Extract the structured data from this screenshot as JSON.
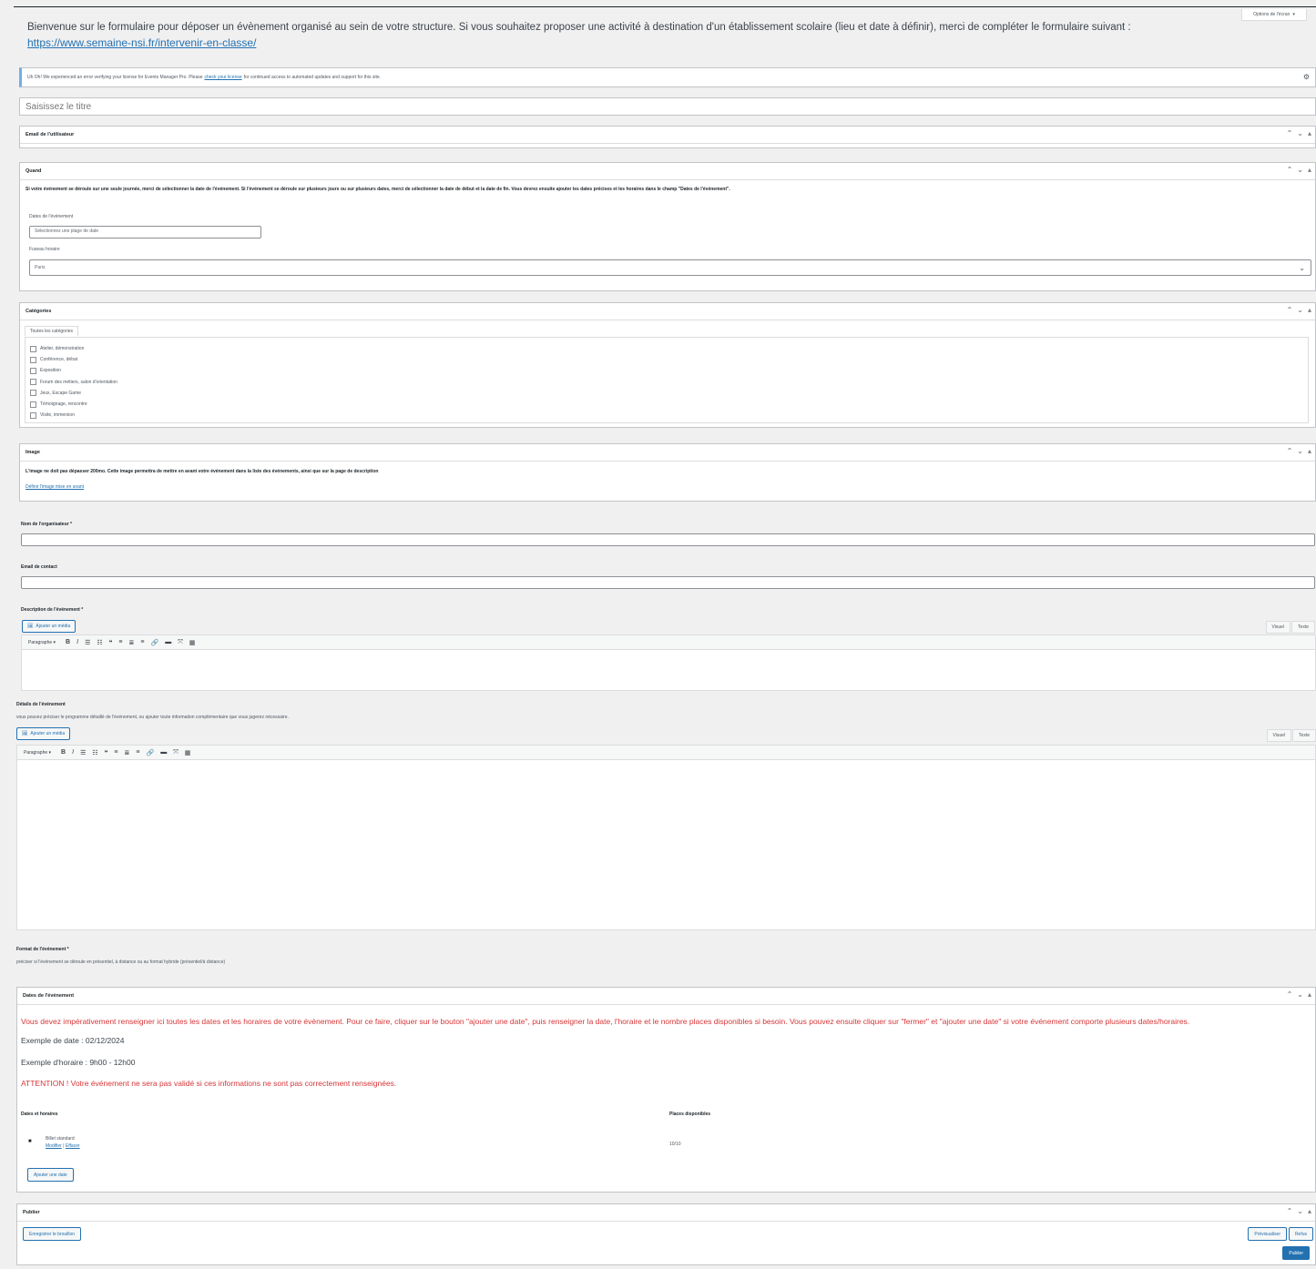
{
  "screen_options": "Options de l'écran",
  "intro": {
    "text": "Bienvenue sur le formulaire pour déposer un évènement organisé au sein de votre structure. Si vous souhaitez proposer une activité à destination d'un établissement scolaire (lieu et date à définir), merci de compléter le formulaire suivant :",
    "link": "https://www.semaine-nsi.fr/intervenir-en-classe/"
  },
  "notice": {
    "before": "Uh Oh! We experienced an error verifying your license for Events Manager Pro. Please",
    "link": "check your license",
    "after": "for continued access to automated updates and support for this site."
  },
  "title_placeholder": "Saisissez le titre",
  "email_box": {
    "title": "Email de l'utilisateur"
  },
  "when_box": {
    "title": "Quand",
    "help": "Si votre événement se déroule sur une seule journée, merci de sélectionner la date de l'événement. Si l'événement se déroule sur plusieurs jours ou sur plusieurs dates, merci de sélectionner la date de début et la date de fin. Vous devrez ensuite ajouter les dates précises et les horaires dans le champ \"Dates de l'événement\".",
    "dates_label": "Dates de l'événement",
    "dates_placeholder": "Sélectionnez une plage de date",
    "tz_label": "Fuseau horaire",
    "tz_value": "Paris"
  },
  "categories_box": {
    "title": "Catégories",
    "tab": "Toutes les catégories",
    "items": [
      "Atelier, démonstration",
      "Conférence, débat",
      "Exposition",
      "Forum des métiers, salon d'orientation",
      "Jeux, Escape Game",
      "Témoignage, rencontre",
      "Visite, immersion"
    ]
  },
  "image_box": {
    "title": "Image",
    "help": "L'image ne doit pas dépasser 200mo. Cette image permettra de mettre en avant votre événement dans la liste des événements, ainsi que sur la page de description",
    "link": "Définir l'image mise en avant"
  },
  "organizer": {
    "label": "Nom de l'organisateur *"
  },
  "contact": {
    "label": "Email de contact"
  },
  "description": {
    "label": "Description de l'événement *",
    "media": "Ajouter un média",
    "visual": "Visuel",
    "text": "Texte",
    "paragraph": "Paragraphe"
  },
  "details": {
    "label": "Détails de l'événement",
    "help": "vous pouvez préciser le programme détaillé de l'événement, ou ajouter toute information complémentaire que vous jugerez nécessaire.",
    "media": "Ajouter un média",
    "visual": "Visuel",
    "text": "Texte",
    "paragraph": "Paragraphe"
  },
  "format": {
    "label": "Format de l'événement *",
    "help": "préciser si l'événement se déroule en présentiel, à distance ou au format hybride (présentiel/à distance)"
  },
  "dates_box": {
    "title": "Dates de l'événement",
    "instructions": "Vous devez impérativement renseigner ici toutes les dates et les horaires de votre évènement. Pour ce faire, cliquer sur le bouton \"ajouter une date\", puis renseigner la date, l'horaire et le nombre places disponibles si besoin. Vous pouvez ensuite cliquer sur \"fermer\" et \"ajouter une date\" si votre événement comporte plusieurs dates/horaires.",
    "example_date": "Exemple de date : 02/12/2024",
    "example_time": "Exemple d'horaire : 9h00 - 12h00",
    "warning": "ATTENTION ! Votre événement ne sera pas validé si ces informations ne sont pas correctement renseignées.",
    "col_dates": "Dates et horaires",
    "col_places": "Places disponibles",
    "ticket_name": "Billet standard",
    "edit": "Modifier",
    "separator": "|",
    "delete": "Effacer",
    "places": "10/10",
    "add_button": "Ajouter une date"
  },
  "publish_box": {
    "title": "Publier",
    "save_draft": "Enregistrer le brouillon",
    "preview": "Prévisualiser",
    "refuse": "Refus",
    "publish": "Publier"
  }
}
